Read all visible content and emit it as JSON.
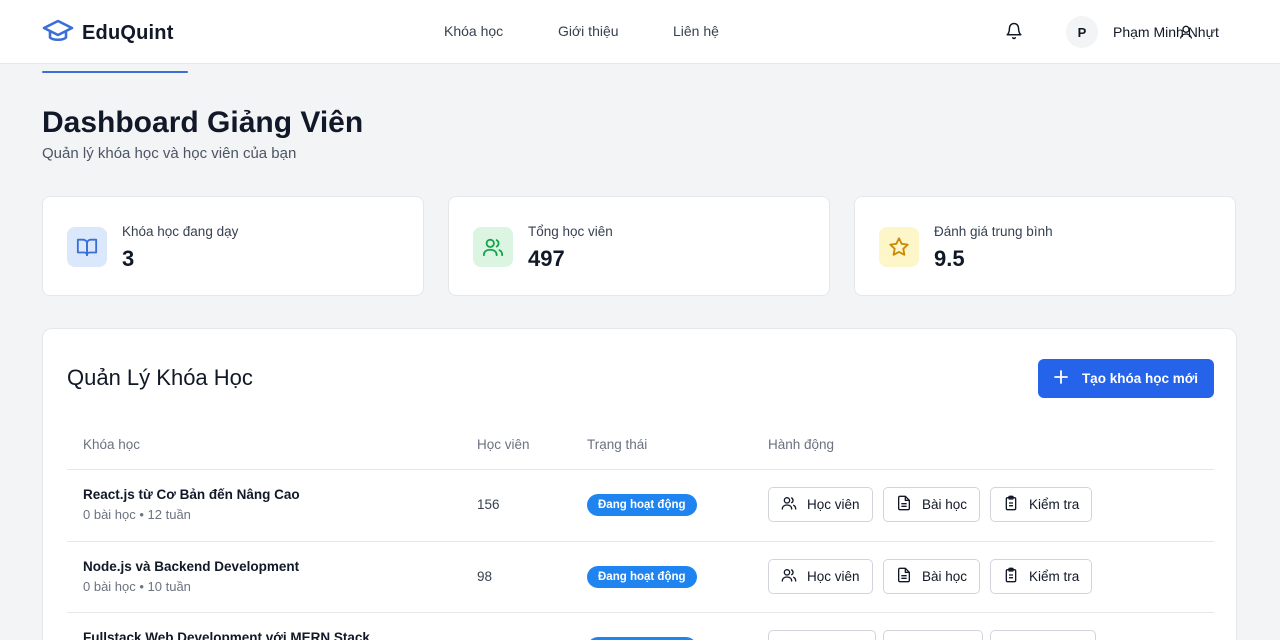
{
  "brand": {
    "name": "EduQuint"
  },
  "nav": {
    "courses": "Khóa học",
    "about": "Giới thiệu",
    "contact": "Liên hệ"
  },
  "user": {
    "initial": "P",
    "name": "Phạm Minh Nhựt"
  },
  "page": {
    "title": "Dashboard Giảng Viên",
    "subtitle": "Quản lý khóa học và học viên của bạn"
  },
  "stats": [
    {
      "label": "Khóa học đang dạy",
      "value": "3",
      "icon": "book-icon",
      "color": "#dbe7fb"
    },
    {
      "label": "Tổng học viên",
      "value": "497",
      "icon": "users-icon",
      "color": "#dcf5e3"
    },
    {
      "label": "Đánh giá trung bình",
      "value": "9.5",
      "icon": "star-icon",
      "color": "#fdf6c9"
    }
  ],
  "management": {
    "title": "Quản Lý Khóa Học",
    "create_button": "Tạo khóa học mới",
    "columns": [
      "Khóa học",
      "Học viên",
      "Trạng thái",
      "Hành động"
    ],
    "actions": {
      "students": "Học viên",
      "lessons": "Bài học",
      "quiz": "Kiểm tra"
    },
    "courses": [
      {
        "name": "React.js từ Cơ Bản đến Nâng Cao",
        "meta": "0 bài học • 12 tuần",
        "students": "156",
        "status": "Đang hoạt động"
      },
      {
        "name": "Node.js và Backend Development",
        "meta": "0 bài học • 10 tuần",
        "students": "98",
        "status": "Đang hoạt động"
      },
      {
        "name": "Fullstack Web Development với MERN Stack",
        "meta": "",
        "students": "",
        "status": ""
      }
    ]
  },
  "colors": {
    "primary": "#2563eb",
    "badge": "#2084f0",
    "book_icon": "#3b6fd6",
    "users_icon": "#16a34a",
    "star_icon": "#ca8a04"
  }
}
